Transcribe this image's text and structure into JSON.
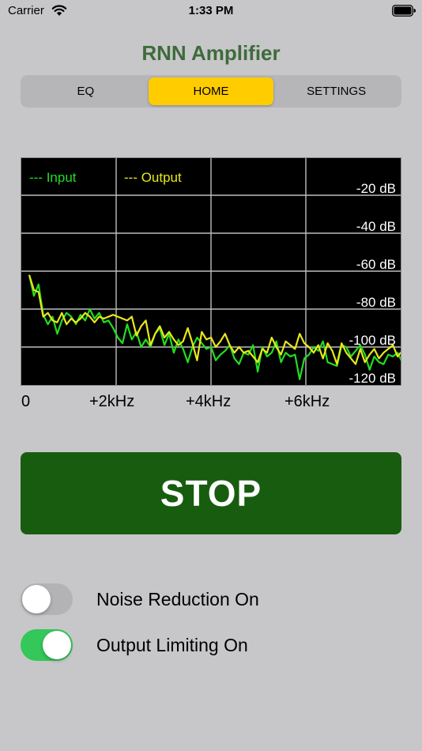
{
  "status_bar": {
    "carrier": "Carrier",
    "time": "1:33 PM"
  },
  "app": {
    "title": "RNN Amplifier"
  },
  "tabs": [
    {
      "label": "EQ",
      "active": false
    },
    {
      "label": "HOME",
      "active": true
    },
    {
      "label": "SETTINGS",
      "active": false
    }
  ],
  "spectrum": {
    "legend": {
      "input": "--- Input",
      "output": "--- Output"
    },
    "db_labels": [
      "-20 dB",
      "-40 dB",
      "-60 dB",
      "-80 dB",
      "-100 dB",
      "-120 dB"
    ],
    "freq_labels": [
      "0",
      "+2kHz",
      "+4kHz",
      "+6kHz"
    ],
    "colors": {
      "input": "#22dd22",
      "output": "#e8e81a",
      "grid": "#bdbdbd"
    },
    "input_db": [
      -62,
      -73,
      -67,
      -83,
      -88,
      -84,
      -93,
      -86,
      -82,
      -84,
      -88,
      -83,
      -86,
      -80,
      -85,
      -82,
      -87,
      -86,
      -90,
      -95,
      -98,
      -88,
      -96,
      -92,
      -100,
      -96,
      -100,
      -93,
      -90,
      -99,
      -93,
      -103,
      -96,
      -101,
      -108,
      -100,
      -95,
      -98,
      -101,
      -100,
      -107,
      -104,
      -102,
      -99,
      -106,
      -109,
      -103,
      -104,
      -99,
      -113,
      -100,
      -105,
      -103,
      -97,
      -108,
      -103,
      -105,
      -104,
      -117,
      -106,
      -104,
      -100,
      -102,
      -97,
      -108,
      -109,
      -110,
      -99,
      -100,
      -105,
      -102,
      -99,
      -104,
      -112,
      -105,
      -108,
      -109,
      -104,
      -105,
      -103,
      -108
    ],
    "output_db": [
      -62,
      -70,
      -71,
      -84,
      -82,
      -86,
      -87,
      -82,
      -88,
      -85,
      -87,
      -85,
      -82,
      -84,
      -87,
      -84,
      -85,
      -84,
      -83,
      -84,
      -85,
      -86,
      -84,
      -94,
      -89,
      -86,
      -99,
      -93,
      -89,
      -95,
      -92,
      -96,
      -99,
      -97,
      -90,
      -98,
      -107,
      -92,
      -96,
      -95,
      -100,
      -97,
      -93,
      -99,
      -103,
      -100,
      -103,
      -102,
      -105,
      -108,
      -101,
      -103,
      -95,
      -100,
      -104,
      -97,
      -99,
      -101,
      -93,
      -98,
      -100,
      -103,
      -99,
      -106,
      -98,
      -102,
      -109,
      -98,
      -103,
      -106,
      -109,
      -101,
      -108,
      -104,
      -101,
      -106,
      -103,
      -101,
      -99,
      -105,
      -102
    ]
  },
  "actions": {
    "stop_label": "STOP"
  },
  "toggles": [
    {
      "label": "Noise Reduction On",
      "on": false
    },
    {
      "label": "Output Limiting On",
      "on": true
    }
  ]
}
